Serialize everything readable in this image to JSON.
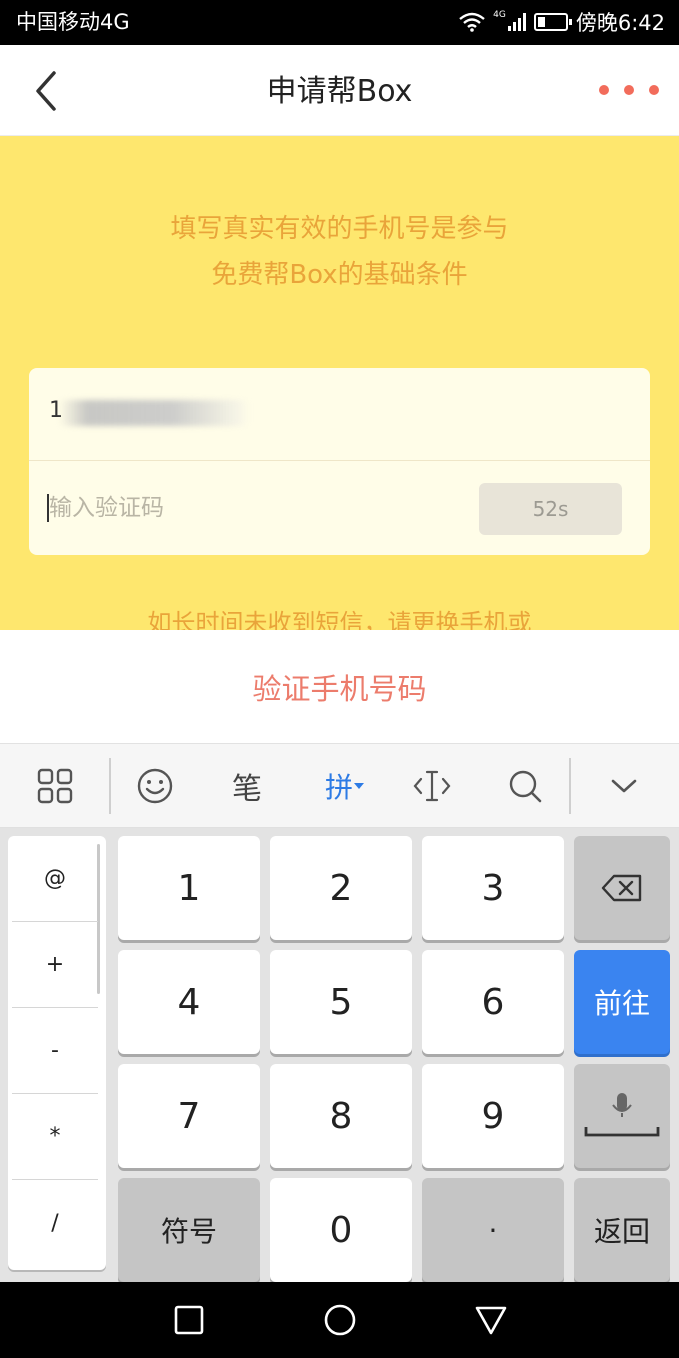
{
  "status_bar": {
    "carrier": "中国移动4G",
    "network_badge": "4G",
    "time": "傍晚6:42"
  },
  "header": {
    "title": "申请帮Box",
    "back_icon": "chevron-left-icon",
    "more_icon": "more-dots-icon",
    "more_color": "#f26c5b"
  },
  "main": {
    "tip_line1": "填写真实有效的手机号是参与",
    "tip_line2": "免费帮Box的基础条件",
    "phone_value": "1",
    "code_placeholder": "输入验证码",
    "countdown": "52s",
    "help_text": "如长时间未收到短信，请更换手机或"
  },
  "verify_button": "验证手机号码",
  "keyboard": {
    "toolbar": {
      "handwriting_label": "笔",
      "pinyin_label": "拼",
      "icons": [
        "grid-icon",
        "emoji-icon",
        "handwriting-icon",
        "pinyin-icon",
        "cursor-icon",
        "search-icon",
        "collapse-icon"
      ]
    },
    "symbols": [
      "@",
      "+",
      "-",
      "*",
      "/"
    ],
    "keys": {
      "k1": "1",
      "k2": "2",
      "k3": "3",
      "k4": "4",
      "k5": "5",
      "k6": "6",
      "k7": "7",
      "k8": "8",
      "k9": "9",
      "symbol_key": "符号",
      "k0": "0",
      "dot": "·",
      "go_key": "前往",
      "back_key": "返回"
    }
  },
  "colors": {
    "yellow_bg": "#fee76e",
    "accent_text": "#e9a43a",
    "verify_text": "#ec7c6c",
    "go_key_blue": "#3a84f0"
  }
}
